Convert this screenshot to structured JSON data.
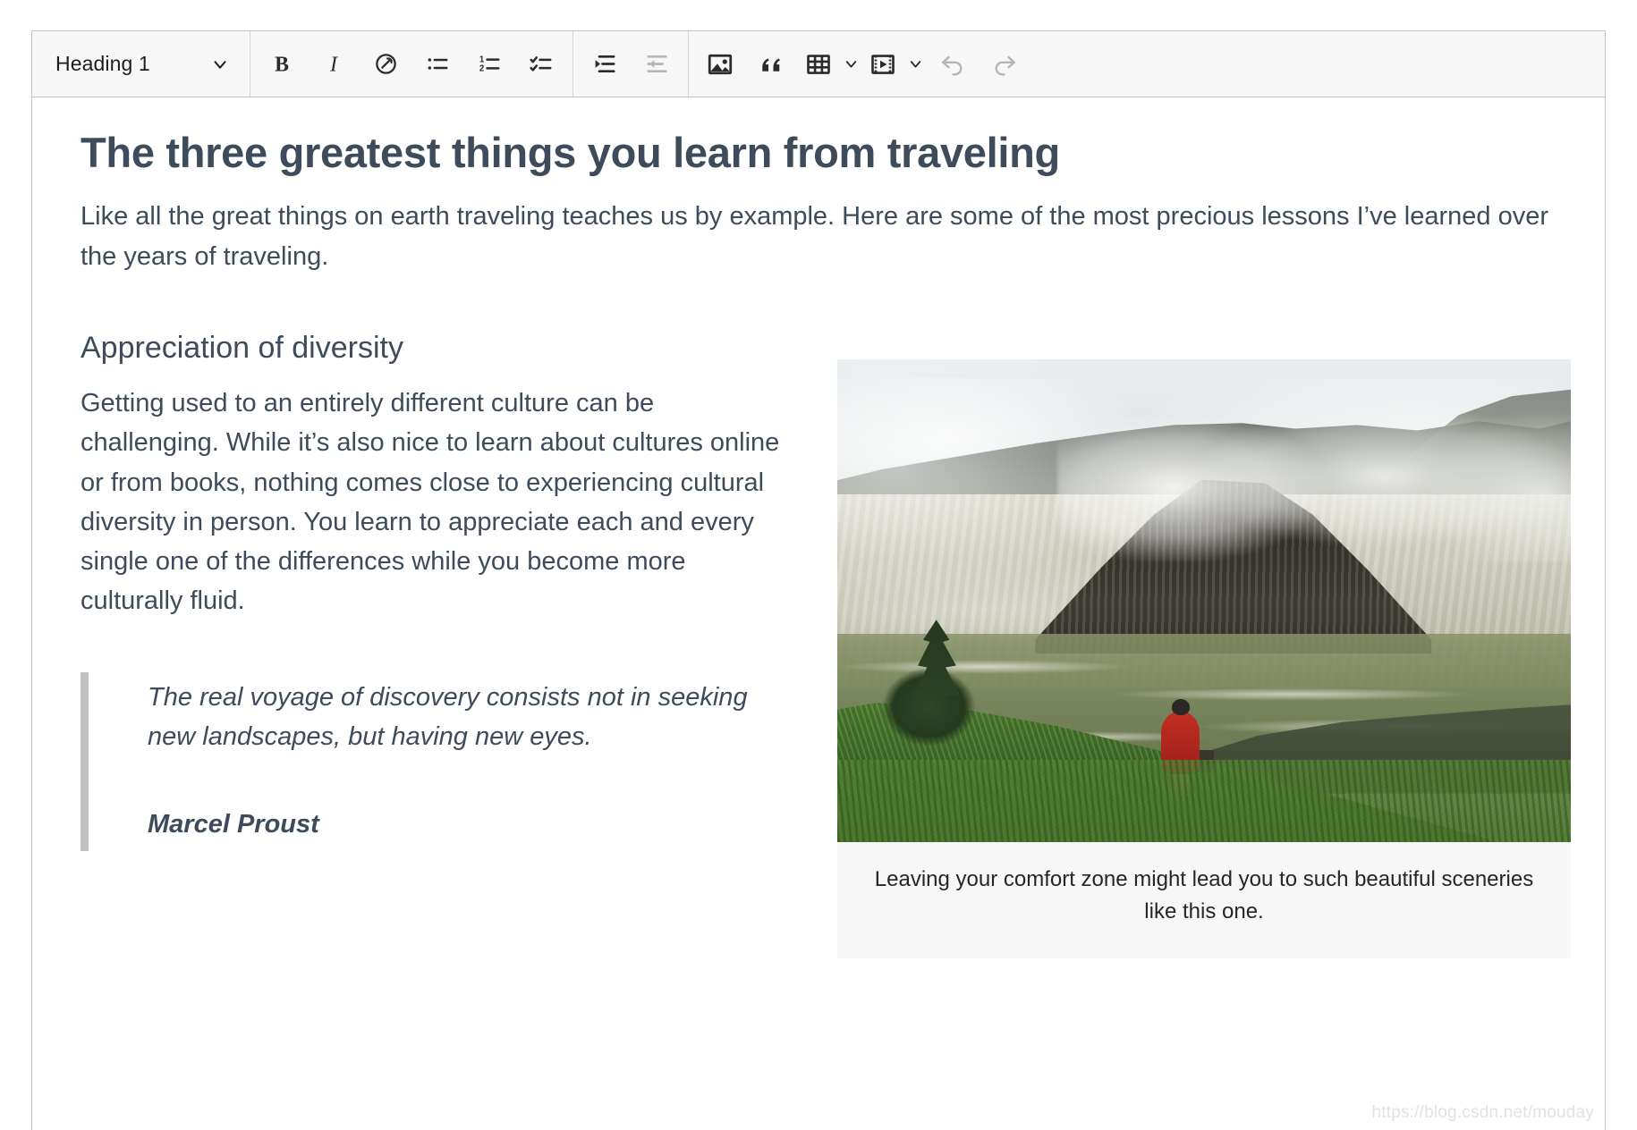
{
  "toolbar": {
    "heading_select": {
      "value": "Heading 1",
      "icon": "chevron-down-icon"
    },
    "groups": [
      {
        "name": "format-group",
        "buttons": [
          {
            "name": "bold-button",
            "icon": "bold-icon",
            "label": "B",
            "disabled": false
          },
          {
            "name": "italic-button",
            "icon": "italic-icon",
            "label": "I",
            "disabled": false
          },
          {
            "name": "link-button",
            "icon": "link-icon",
            "label": "Link",
            "disabled": false
          },
          {
            "name": "bulleted-list-button",
            "icon": "bulleted-list-icon",
            "label": "Bulleted list",
            "disabled": false
          },
          {
            "name": "numbered-list-button",
            "icon": "numbered-list-icon",
            "label": "Numbered list",
            "disabled": false
          },
          {
            "name": "todo-list-button",
            "icon": "checklist-icon",
            "label": "To-do list",
            "disabled": false
          }
        ]
      },
      {
        "name": "indent-group",
        "buttons": [
          {
            "name": "increase-indent-button",
            "icon": "indent-icon",
            "label": "Increase indent",
            "disabled": false
          },
          {
            "name": "decrease-indent-button",
            "icon": "outdent-icon",
            "label": "Decrease indent",
            "disabled": true
          }
        ]
      },
      {
        "name": "insert-group",
        "buttons": [
          {
            "name": "insert-image-button",
            "icon": "image-icon",
            "label": "Insert image",
            "disabled": false
          },
          {
            "name": "block-quote-button",
            "icon": "quote-icon",
            "label": "Block quote",
            "disabled": false
          },
          {
            "name": "insert-table-button",
            "icon": "table-icon",
            "label": "Insert table",
            "disabled": false,
            "caret": "chevron-down-icon"
          },
          {
            "name": "insert-media-button",
            "icon": "media-icon",
            "label": "Insert media",
            "disabled": false,
            "caret": "chevron-down-icon"
          },
          {
            "name": "undo-button",
            "icon": "undo-icon",
            "label": "Undo",
            "disabled": true
          },
          {
            "name": "redo-button",
            "icon": "redo-icon",
            "label": "Redo",
            "disabled": true
          }
        ]
      }
    ]
  },
  "document": {
    "title": "The three greatest things you learn from traveling",
    "intro": "Like all the great things on earth traveling teaches us by example. Here are some of the most precious lessons I’ve learned over the years of traveling.",
    "section": {
      "heading": "Appreciation of diversity",
      "paragraph": "Getting used to an entirely different culture can be challenging. While it’s also nice to learn about cultures online or from books, nothing comes close to experiencing cultural diversity in person. You learn to appreciate each and every single one of the differences while you become more culturally fluid."
    },
    "blockquote": {
      "text": "The real voyage of discovery consists not in seeking new landscapes, but having new eyes.",
      "author": "Marcel Proust"
    },
    "figure": {
      "image_alt": "Person in a red jacket standing on a grassy hill overlooking a steaming volcano crater",
      "caption": "Leaving your comfort zone might lead you to such beautiful sceneries like this one."
    }
  },
  "watermark": "https://blog.csdn.net/mouday",
  "colors": {
    "text": "#3e4b5b",
    "toolbar_bg": "#f7f7f7",
    "border": "#c4c4c4",
    "quote_bar": "#c0c0c0",
    "caption_bg": "#f7f7f7",
    "disabled_icon": "#b5b5b5"
  }
}
